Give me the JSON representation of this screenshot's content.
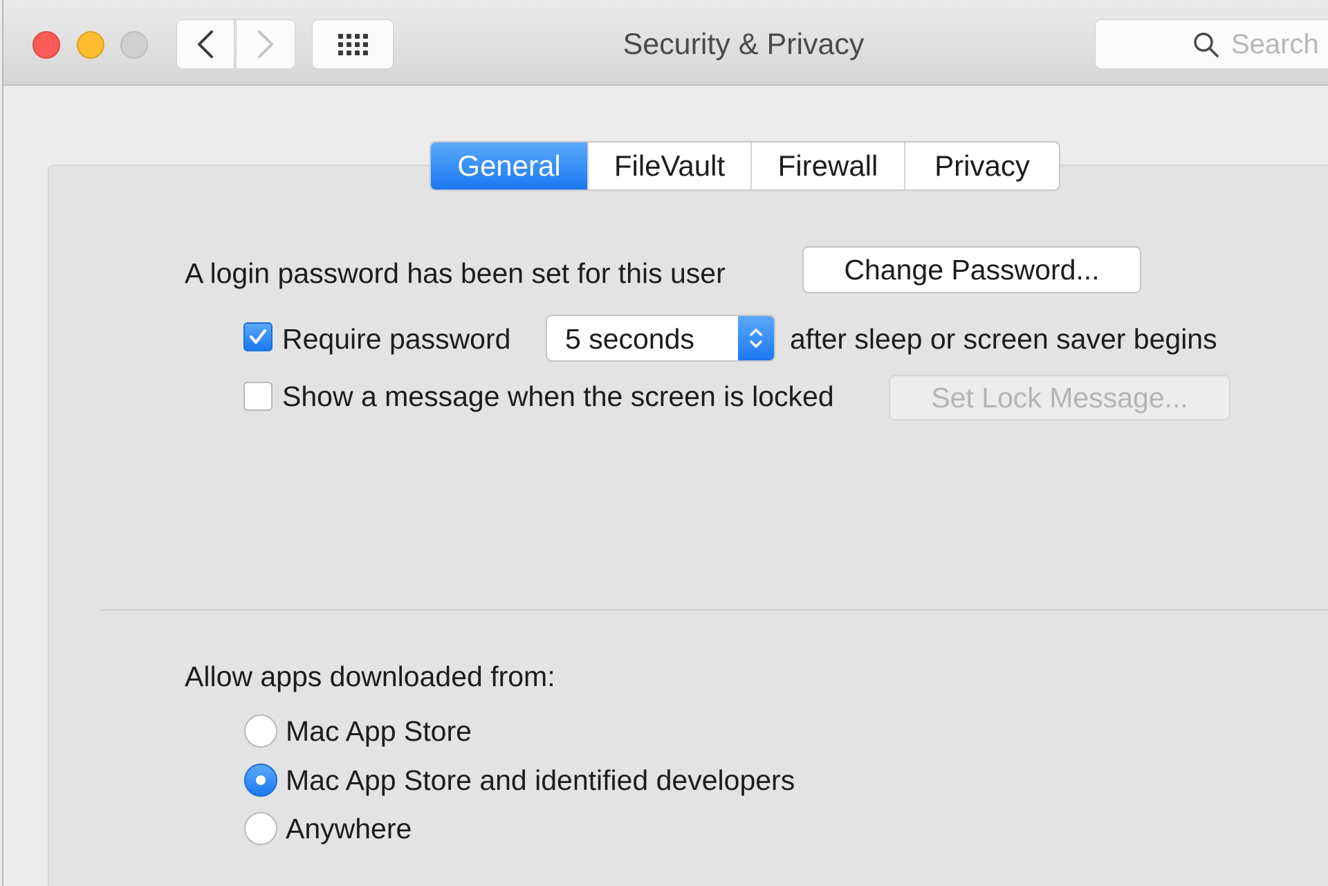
{
  "window": {
    "title": "Security & Privacy"
  },
  "toolbar": {
    "back_icon": "chevron-left-icon",
    "forward_icon": "chevron-right-icon",
    "grid_icon": "show-all-grid-icon"
  },
  "search": {
    "placeholder": "Search",
    "icon": "search-icon"
  },
  "tabs": [
    {
      "label": "General",
      "active": true
    },
    {
      "label": "FileVault",
      "active": false
    },
    {
      "label": "Firewall",
      "active": false
    },
    {
      "label": "Privacy",
      "active": false
    }
  ],
  "general": {
    "password_status": "A login password has been set for this user",
    "change_password_button": "Change Password...",
    "require_password": {
      "label": "Require password",
      "checked": true,
      "delay_value": "5 seconds",
      "suffix": "after sleep or screen saver begins"
    },
    "lock_message": {
      "label": "Show a message when the screen is locked",
      "checked": false,
      "button": "Set Lock Message..."
    }
  },
  "gatekeeper": {
    "heading": "Allow apps downloaded from:",
    "options": [
      {
        "label": "Mac App Store",
        "selected": false
      },
      {
        "label": "Mac App Store and identified developers",
        "selected": true
      },
      {
        "label": "Anywhere",
        "selected": false
      }
    ]
  },
  "colors": {
    "accent": "#1b78f2",
    "close": "#fc5b57",
    "minimize": "#fdbd2e",
    "zoom_disabled": "#d0d0d0"
  }
}
